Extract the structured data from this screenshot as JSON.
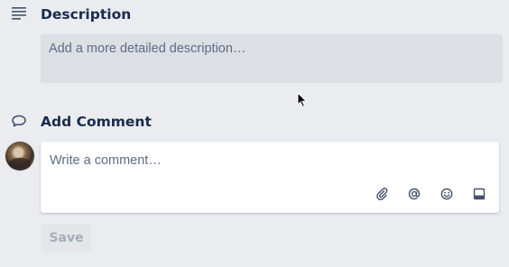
{
  "description": {
    "heading": "Description",
    "icon": "description-lines-icon",
    "placeholder": "Add a more detailed description…"
  },
  "comment": {
    "heading": "Add Comment",
    "icon": "comment-bubble-icon",
    "placeholder": "Write a comment…",
    "avatar": "user-avatar",
    "tools": [
      "attachment-icon",
      "mention-icon",
      "emoji-icon",
      "card-icon"
    ],
    "save_label": "Save"
  },
  "colors": {
    "background": "#ebecf0",
    "heading_text": "#172b4d",
    "placeholder_text": "#5e6c84",
    "description_box": "#dcdfe4",
    "comment_box": "#ffffff",
    "save_disabled_bg": "#e4e6ea",
    "save_disabled_text": "#a5adba"
  }
}
